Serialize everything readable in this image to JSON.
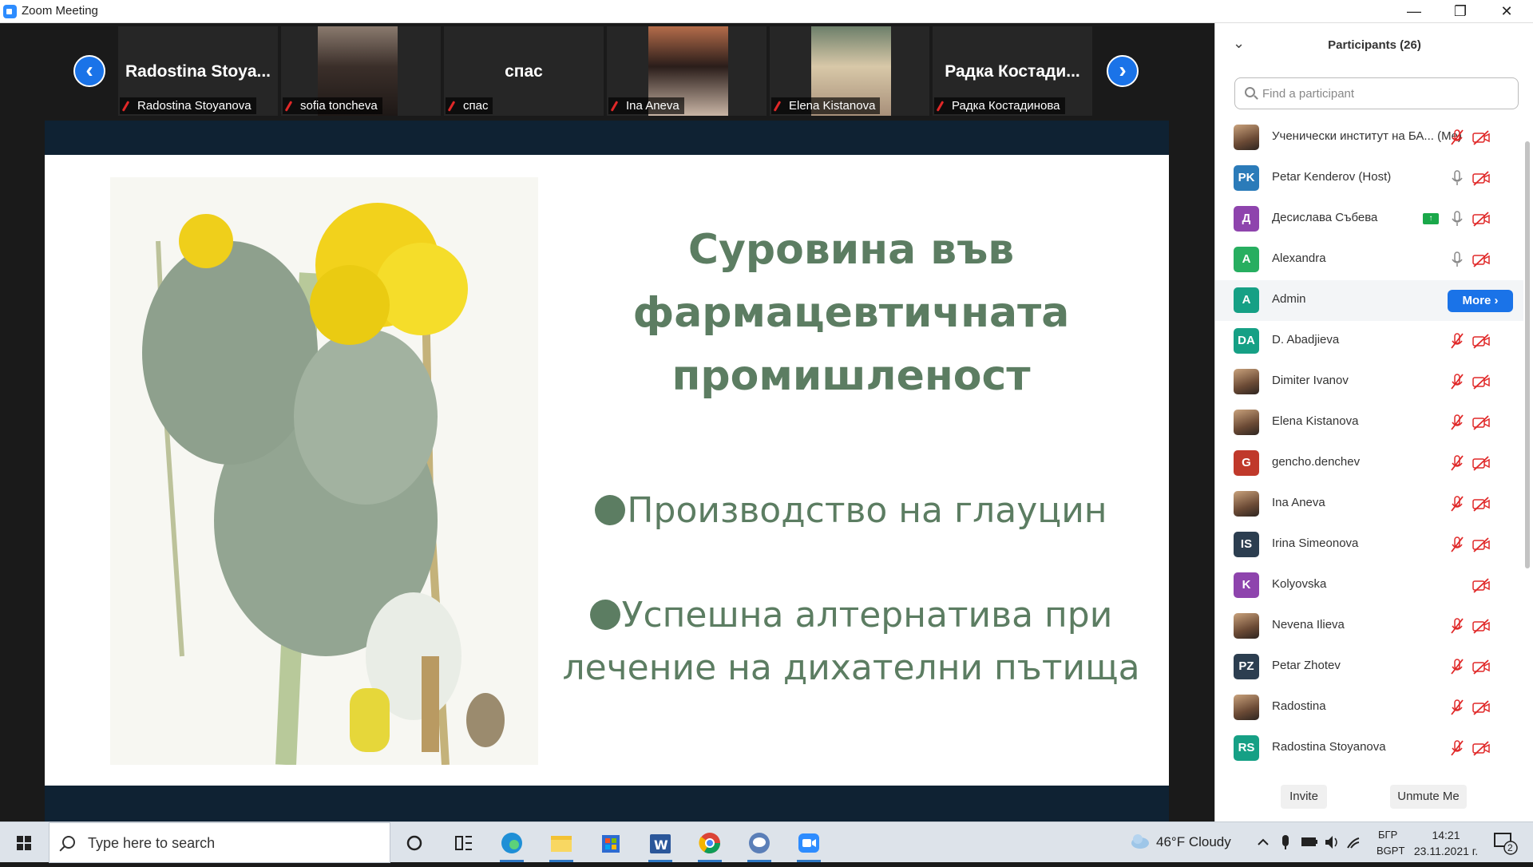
{
  "window": {
    "title": "Zoom Meeting",
    "minimize": "—",
    "maximize": "❐",
    "close": "✕"
  },
  "gallery": {
    "prev_arrow": "‹",
    "next_arrow": "›",
    "tiles": [
      {
        "big": "Radostina  Stoya...",
        "label": "Radostina Stoyanova"
      },
      {
        "big": "",
        "label": "sofia toncheva"
      },
      {
        "big": "спас",
        "label": "спас"
      },
      {
        "big": "",
        "label": "Ina Aneva"
      },
      {
        "big": "",
        "label": "Elena Kistanova"
      },
      {
        "big": "Радка  Костади...",
        "label": "Радка Костадинова"
      }
    ]
  },
  "slide": {
    "title_lines": [
      "Суровина във",
      "фармацевтичната",
      "промишленост"
    ],
    "bullet1": "Производство на глауцин",
    "bullet2_line1": "Успешна алтернатива при",
    "bullet2_line2": "лечение на дихателни пътища"
  },
  "participants": {
    "collapse_icon": "⌄",
    "title": "Participants (26)",
    "search_placeholder": "Find a participant",
    "more_label": "More ›",
    "invite_label": "Invite",
    "unmute_label": "Unmute Me",
    "list": [
      {
        "initials": "",
        "color": "",
        "name": "Ученически институт на БА... (Me)",
        "mic": "muted",
        "cam": "off"
      },
      {
        "initials": "PK",
        "color": "#2b7bb9",
        "name": "Petar Kenderov (Host)",
        "mic": "on",
        "cam": "off"
      },
      {
        "initials": "Д",
        "color": "#8e44ad",
        "name": "Десислава Събева",
        "mic": "on",
        "cam": "off",
        "sharing": "↑"
      },
      {
        "initials": "A",
        "color": "#27ae60",
        "name": "Alexandra",
        "mic": "on",
        "cam": "off"
      },
      {
        "initials": "A",
        "color": "#16a085",
        "name": "Admin",
        "more": true
      },
      {
        "initials": "DA",
        "color": "#16a085",
        "name": "D. Abadjieva",
        "mic": "muted",
        "cam": "off"
      },
      {
        "initials": "",
        "color": "",
        "name": "Dimiter Ivanov",
        "mic": "muted",
        "cam": "off"
      },
      {
        "initials": "",
        "color": "",
        "name": "Elena Kistanova",
        "mic": "muted",
        "cam": "off"
      },
      {
        "initials": "G",
        "color": "#c0392b",
        "name": "gencho.denchev",
        "mic": "muted",
        "cam": "off"
      },
      {
        "initials": "",
        "color": "",
        "name": "Ina Aneva",
        "mic": "muted",
        "cam": "off"
      },
      {
        "initials": "IS",
        "color": "#2c3e50",
        "name": "Irina Simeonova",
        "mic": "muted",
        "cam": "off"
      },
      {
        "initials": "K",
        "color": "#8e44ad",
        "name": "Kolyovska",
        "mic": "",
        "cam": "off"
      },
      {
        "initials": "",
        "color": "",
        "name": "Nevena Ilieva",
        "mic": "muted",
        "cam": "off"
      },
      {
        "initials": "PZ",
        "color": "#2c3e50",
        "name": "Petar Zhotev",
        "mic": "muted",
        "cam": "off"
      },
      {
        "initials": "",
        "color": "",
        "name": "Radostina",
        "mic": "muted",
        "cam": "off"
      },
      {
        "initials": "RS",
        "color": "#16a085",
        "name": "Radostina Stoyanova",
        "mic": "muted",
        "cam": "off"
      }
    ]
  },
  "taskbar": {
    "search_placeholder": "Type here to search",
    "weather": "46°F  Cloudy",
    "lang_top": "БГР",
    "lang_bottom": "BGPT",
    "time": "14:21",
    "date": "23.11.2021 г.",
    "notif_count": "2",
    "apps": [
      "cortana-icon",
      "task-view-icon",
      "edge-icon",
      "file-explorer-icon",
      "store-icon",
      "word-icon",
      "chrome-icon",
      "teams-chat-icon",
      "zoom-icon"
    ]
  },
  "colors": {
    "accent": "#2D8CFF",
    "slide_text": "#5c7d62",
    "muted_red": "#e02828"
  }
}
